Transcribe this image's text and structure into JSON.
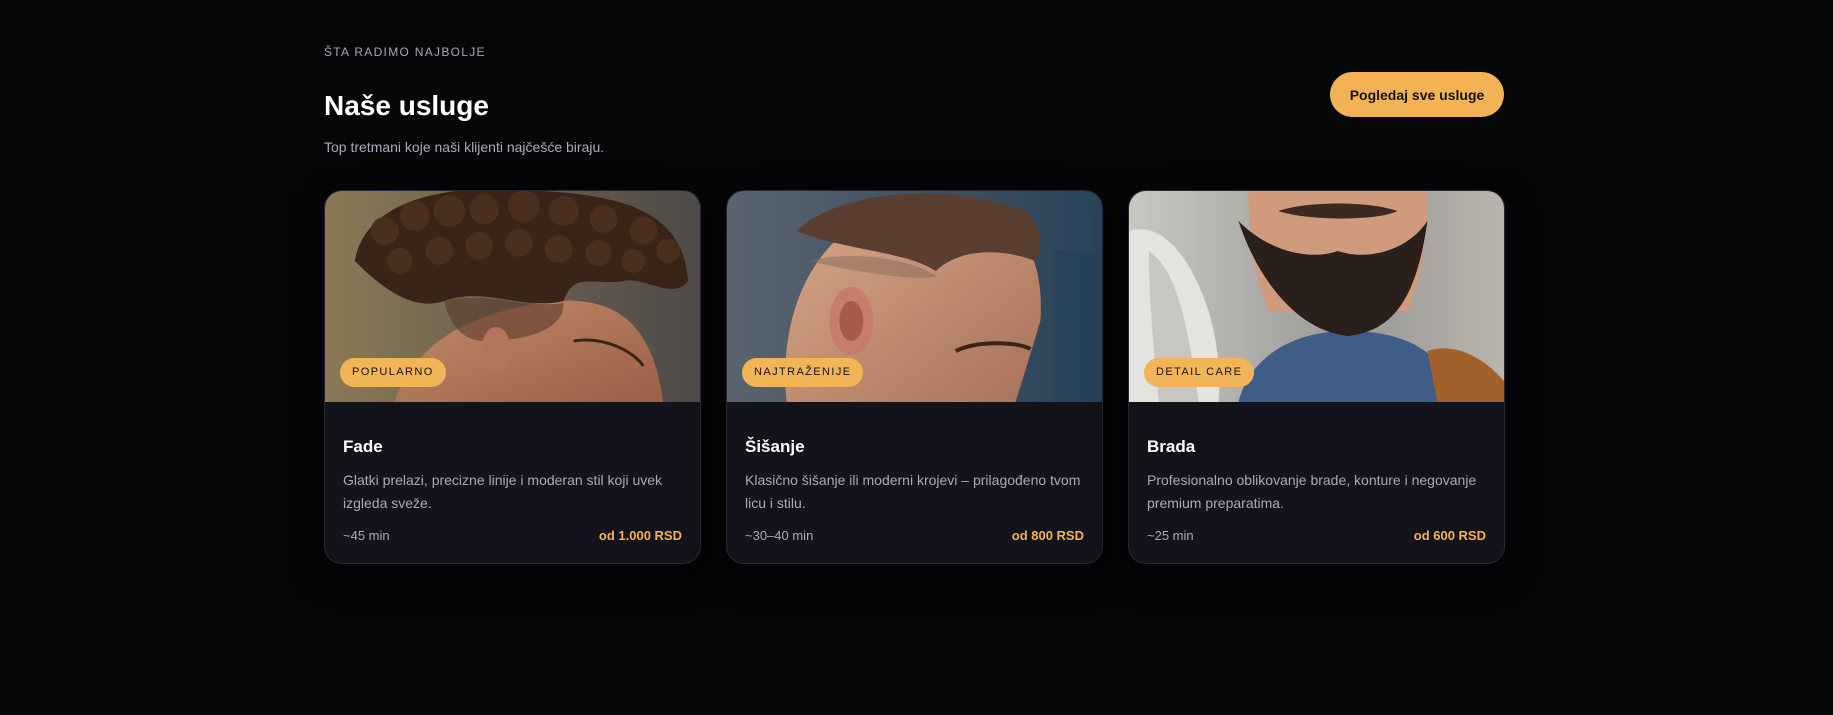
{
  "header": {
    "eyebrow": "ŠTA RADIMO NAJBOLJE",
    "title": "Naše usluge",
    "subtitle": "Top tretmani koje naši klijenti najčešće biraju.",
    "cta_label": "Pogledaj sve usluge"
  },
  "cards": [
    {
      "badge": "POPULARNO",
      "title": "Fade",
      "description": "Glatki prelazi, precizne linije i moderan stil koji uvek izgleda sveže.",
      "duration": "~45 min",
      "price": "od 1.000 RSD"
    },
    {
      "badge": "NAJTRAŽENIJE",
      "title": "Šišanje",
      "description": "Klasično šišanje ili moderni krojevi – prilagođeno tvom licu i stilu.",
      "duration": "~30–40 min",
      "price": "od 800 RSD"
    },
    {
      "badge": "DETAIL CARE",
      "title": "Brada",
      "description": "Profesionalno oblikovanje brade, konture i negovanje premium preparatima.",
      "duration": "~25 min",
      "price": "od 600 RSD"
    }
  ],
  "colors": {
    "background": "#060609",
    "card": "#12131b",
    "accent": "#f3b354"
  }
}
